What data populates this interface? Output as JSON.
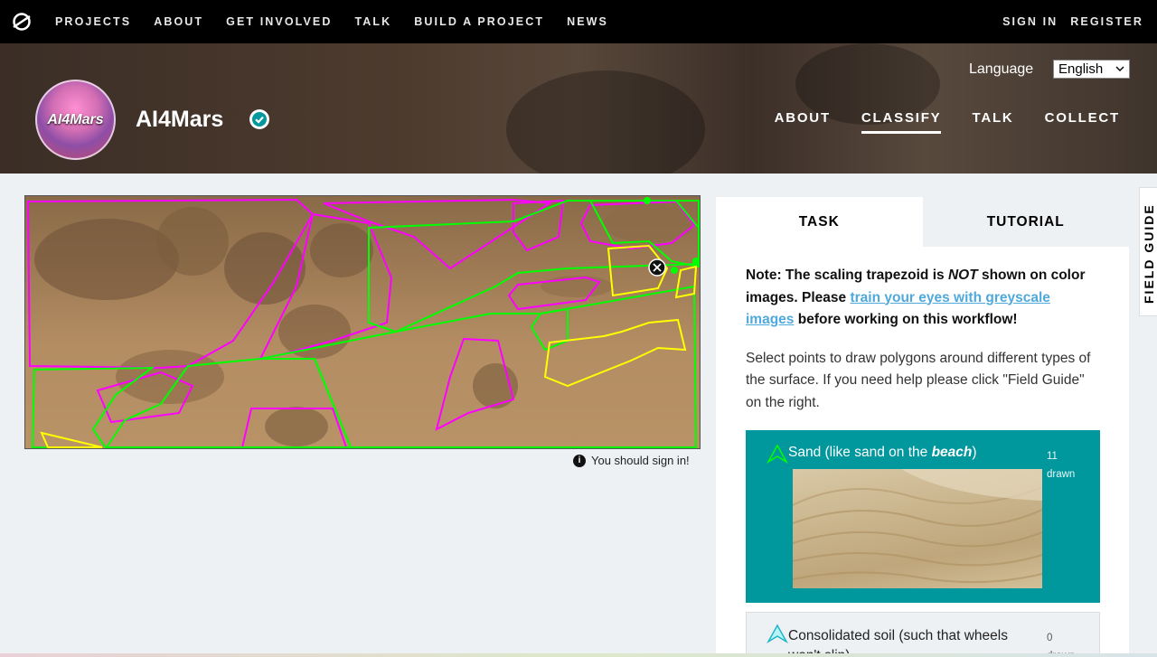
{
  "topnav": {
    "links": [
      "PROJECTS",
      "ABOUT",
      "GET INVOLVED",
      "TALK",
      "BUILD A PROJECT",
      "NEWS"
    ],
    "sign_in": "SIGN IN",
    "register": "REGISTER"
  },
  "project": {
    "avatar_text": "AI4Mars",
    "title": "AI4Mars",
    "nav": [
      "ABOUT",
      "CLASSIFY",
      "TALK",
      "COLLECT"
    ],
    "active_nav": "CLASSIFY"
  },
  "language": {
    "label": "Language",
    "selected": "English"
  },
  "subject": {
    "sign_in_note": "You should sign in!"
  },
  "panel": {
    "tabs": [
      "TASK",
      "TUTORIAL"
    ],
    "active_tab": "TASK",
    "note_prefix": "Note: The scaling trapezoid is ",
    "note_emph": "NOT",
    "note_mid": " shown on color images. Please ",
    "note_link": "train your eyes with greyscale images",
    "note_suffix": " before working on this workflow!",
    "instructions": "Select points to draw polygons around different types of the surface. If you need help please click \"Field Guide\" on the right.",
    "answers": [
      {
        "label_prefix": "Sand (like sand on the ",
        "label_emph": "beach",
        "label_suffix": ")",
        "count": "11",
        "count_unit": "drawn",
        "color": "#00ff00"
      },
      {
        "label": "Consolidated soil (such that wheels won't slip)",
        "count": "0",
        "count_unit": "drawn",
        "color": "#00ffff"
      }
    ]
  },
  "field_guide": "FIELD GUIDE",
  "colors": {
    "teal": "#00979d",
    "sand_outline": "#00ff00",
    "rock_outline": "#ff00ff",
    "yellow_outline": "#ffff00",
    "link": "#4fa9dc"
  }
}
